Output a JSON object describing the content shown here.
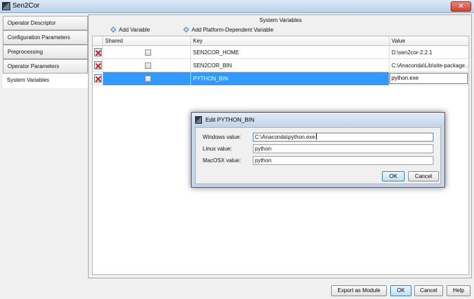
{
  "window": {
    "title": "Sen2Cor",
    "close_glyph": "✕"
  },
  "nav": {
    "items": [
      {
        "label": "Operator Descriptor"
      },
      {
        "label": "Configuration Parameters"
      },
      {
        "label": "Preprocessing"
      },
      {
        "label": "Operator Parameters"
      },
      {
        "label": "System Variables"
      }
    ],
    "active_index": 4
  },
  "panel": {
    "title": "System Variables",
    "add_variable": "Add Variable",
    "add_platform_variable": "Add Platform-Dependent Variable"
  },
  "table": {
    "columns": {
      "shared": "Shared",
      "key": "Key",
      "value": "Value"
    },
    "rows": [
      {
        "key": "SEN2COR_HOME",
        "value": "D:\\sen2cor-2.2.1",
        "shared": false
      },
      {
        "key": "SEN2COR_BIN",
        "value": "C:\\Anaconda\\Lib\\site-package...",
        "shared": false
      },
      {
        "key": "PYTHON_BIN",
        "value": "python.exe",
        "shared": false
      }
    ],
    "selected_row": 2,
    "icons": {
      "delete": "delete-row-icon"
    }
  },
  "dialog": {
    "title": "Edit PYTHON_BIN",
    "windows_label": "Windows value:",
    "windows_value": "C:\\Anaconda\\python.exe",
    "linux_label": "Linux value:",
    "linux_value": "python",
    "macosx_label": "MacOSX value:",
    "macosx_value": "python",
    "ok": "OK",
    "cancel": "Cancel"
  },
  "footer": {
    "export": "Export as Module",
    "ok": "OK",
    "cancel": "Cancel",
    "help": "Help"
  },
  "colors": {
    "selection": "#3399ff",
    "titlebar": "#c3d3e7",
    "close": "#c9452f"
  }
}
